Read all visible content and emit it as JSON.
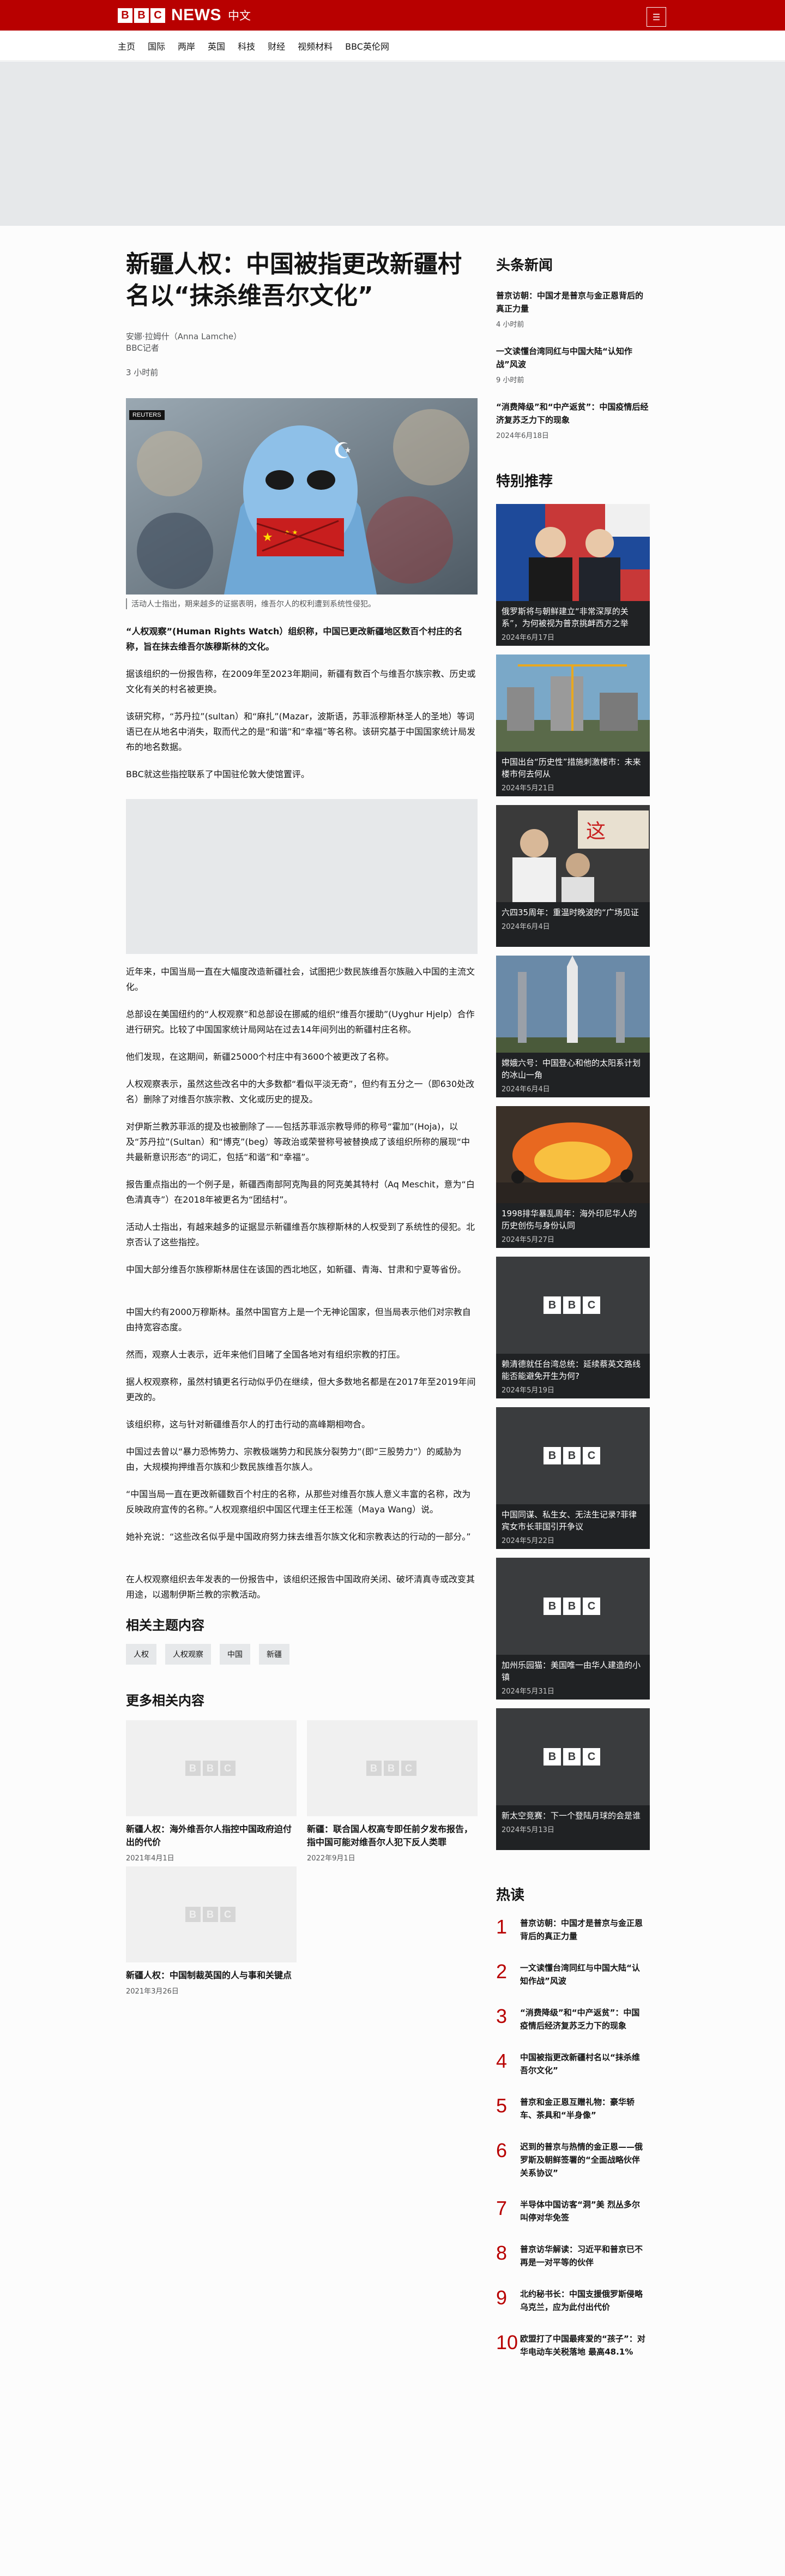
{
  "header": {
    "logo_letters": [
      "B",
      "B",
      "C"
    ],
    "news_label": "NEWS",
    "lang_label": "中文",
    "menu_icon": "☰"
  },
  "nav": {
    "items": [
      "主页",
      "国际",
      "两岸",
      "英国",
      "科技",
      "财经",
      "视频材料",
      "BBC英伦网"
    ]
  },
  "article": {
    "headline": "新疆人权：中国被指更改新疆村名以“抹杀维吾尔文化”",
    "author": "安娜·拉姆什（Anna Lamche）",
    "author_role": "BBC记者",
    "timestamp": "3 小时前",
    "image_badge": "REUTERS",
    "caption": "活动人士指出，期来越多的证据表明，维吾尔人的权利遭到系统性侵犯。",
    "lead": "“人权观察”(Human Rights Watch）组织称，中国已更改新疆地区数百个村庄的名称，旨在抹去维吾尔族穆斯林的文化。",
    "paragraphs": [
      "据该组织的一份报告称，在2009年至2023年期间，新疆有数百个与维吾尔族宗教、历史或文化有关的村名被更换。",
      "该研究称，“苏丹拉”(sultan）和“麻扎”(Mazar，波斯语，苏菲派穆斯林圣人的圣地）等词语已在从地名中消失，取而代之的是“和谐”和“幸福”等名称。该研究基于中国国家统计局发布的地名数据。",
      "BBC就这些指控联系了中国驻伦敦大使馆置评。",
      "近年来，中国当局一直在大幅度改造新疆社会，试图把少数民族维吾尔族融入中国的主流文化。",
      "总部设在美国纽约的“人权观察”和总部设在挪威的组织“维吾尔援助”(Uyghur Hjelp）合作进行研究。比较了中国国家统计局网站在过去14年间列出的新疆村庄名称。",
      "他们发现，在这期间，新疆25000个村庄中有3600个被更改了名称。",
      "人权观察表示，虽然这些改名中的大多数都“看似平淡无奇”，但约有五分之一（即630处改名）删除了对维吾尔族宗教、文化或历史的提及。",
      "对伊斯兰教苏菲派的提及也被删除了——包括苏菲派宗教导师的称号“霍加”(Hoja)，以及“苏丹拉”(Sultan）和“博克”(beg）等政治或荣誉称号被替换成了该组织所称的展现“中共最新意识形态”的词汇，包括“和谐”和“幸福”。",
      "报告重点指出的一个例子是，新疆西南部阿克陶县的阿克美其特村（Aq Meschit，意为“白色清真寺”）在2018年被更名为“团结村”。",
      "活动人士指出，有越来越多的证据显示新疆维吾尔族穆斯林的人权受到了系统性的侵犯。北京否认了这些指控。",
      "中国大部分维吾尔族穆斯林居住在该国的西北地区，如新疆、青海、甘肃和宁夏等省份。",
      "中国大约有2000万穆斯林。虽然中国官方上是一个无神论国家，但当局表示他们对宗教自由持宽容态度。",
      "然而，观察人士表示，近年来他们目睹了全国各地对有组织宗教的打压。",
      "据人权观察称，虽然村镇更名行动似乎仍在继续，但大多数地名都是在2017年至2019年间更改的。",
      "该组织称，这与针对新疆维吾尔人的打击行动的高峰期相吻合。",
      "中国过去曾以“暴力恐怖势力、宗教极端势力和民族分裂势力”(即“三股势力”）的威胁为由，大规模拘押维吾尔族和少数民族维吾尔族人。",
      "“中国当局一直在更改新疆数百个村庄的名称，从那些对维吾尔族人意义丰富的名称，改为反映政府宣传的名称。”人权观察组织中国区代理主任王松莲（Maya Wang）说。",
      "她补充说：“这些改名似乎是中国政府努力抹去维吾尔族文化和宗教表达的行动的一部分。”",
      "在人权观察组织去年发表的一份报告中，该组织还报告中国政府关闭、破坏清真寺或改变其用途，以遏制伊斯兰教的宗教活动。"
    ]
  },
  "related": {
    "title": "相关主题内容",
    "tags": [
      "人权",
      "人权观察",
      "中国",
      "新疆"
    ]
  },
  "more": {
    "title": "更多相关内容",
    "cards": [
      {
        "title": "新疆人权：海外维吾尔人指控中国政府迫付出的代价",
        "date": "2021年4月1日"
      },
      {
        "title": "新疆：联合国人权高专即任前夕发布报告，指中国可能对维吾尔人犯下反人类罪",
        "date": "2022年9月1日"
      },
      {
        "title": "新疆人权：中国制裁英国的人与事和关键点",
        "date": "2021年3月26日"
      }
    ]
  },
  "sidebar": {
    "headlines_title": "头条新闻",
    "headlines": [
      {
        "title": "普京访朝：中国才是普京与金正恩背后的真正力量",
        "time": "4 小时前"
      },
      {
        "title": "一文读懂台湾同红与中国大陆“认知作战”风波",
        "time": "9 小时前"
      },
      {
        "title": "“消费降级”和“中产返贫”：中国疫情后经济复苏乏力下的现象",
        "time": "2024年6月18日"
      }
    ],
    "featured_title": "特别推荐",
    "featured": [
      {
        "title": "俄罗斯将与朝鲜建立“非常深厚的关系”，为何被视为普京挑衅西方之举",
        "date": "2024年6月17日",
        "img": "putin"
      },
      {
        "title": "中国出台“历史性”措施刺激楼市：未来楼市何去何从",
        "date": "2024年5月21日",
        "img": "construction"
      },
      {
        "title": "六四35周年：重温时晚波的“广场见证",
        "date": "2024年6月4日",
        "img": "protest"
      },
      {
        "title": "嫦娥六号：中国登心和他的太阳系计划的冰山一角",
        "date": "2024年6月4日",
        "img": "rocket"
      },
      {
        "title": "1998排华暴乱周年：海外印尼华人的历史创伤与身份认同",
        "date": "2024年5月27日",
        "img": "fire"
      },
      {
        "title": "赖清德就任台湾总统：延续蔡英文路线能否能避免开生为何?",
        "date": "2024年5月19日",
        "img": "bbc"
      },
      {
        "title": "中国同谋、私生女、无法生记录?菲律宾女市长菲国引开争议",
        "date": "2024年5月22日",
        "img": "bbc"
      },
      {
        "title": "加州乐园猫：美国唯一由华人建造的小镇",
        "date": "2024年5月31日",
        "img": "bbc"
      },
      {
        "title": "新太空竞赛：下一个登陆月球的会是谁",
        "date": "2024年5月13日",
        "img": "bbc"
      }
    ],
    "popular_title": "热读",
    "popular": [
      {
        "num": "1",
        "title": "普京访朝：中国才是普京与金正恩背后的真正力量"
      },
      {
        "num": "2",
        "title": "一文读懂台湾同红与中国大陆“认知作战”风波"
      },
      {
        "num": "3",
        "title": "“消费降级”和“中产返贫”：中国疫情后经济复苏乏力下的现象"
      },
      {
        "num": "4",
        "title": "中国被指更改新疆村名以“抹杀维吾尔文化”"
      },
      {
        "num": "5",
        "title": "普京和金正恩互赠礼物：豪华轿车、茶具和“半身像”"
      },
      {
        "num": "6",
        "title": "迟到的普京与热情的金正恩——俄罗斯及朝鲜签署的“全面战略伙伴关系协议”"
      },
      {
        "num": "7",
        "title": "半导体中国访客“洞”美 烈丛多尔叫停对华免签"
      },
      {
        "num": "8",
        "title": "普京访华解读：习近平和普京已不再是一对平等的伙伴"
      },
      {
        "num": "9",
        "title": "北约秘书长：中国支援俄罗斯侵略乌克兰，应为此付出代价"
      },
      {
        "num": "10",
        "title": "欧盟打了中国最疼爱的“孩子”：对华电动车关税落地 最高48.1%"
      }
    ]
  }
}
